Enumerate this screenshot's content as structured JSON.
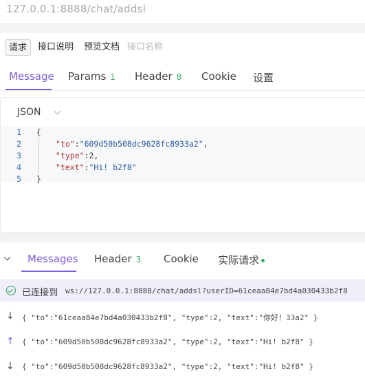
{
  "url": "127.0.0.1:8888/chat/addsl",
  "sub_tabs": [
    {
      "label": "请求"
    },
    {
      "label": "接口说明"
    },
    {
      "label": "预览文档"
    }
  ],
  "api_name_placeholder": "接口名称",
  "main_tabs": [
    {
      "label": "Message",
      "badge": ""
    },
    {
      "label": "Params",
      "badge": "1"
    },
    {
      "label": "Header",
      "badge": "8"
    },
    {
      "label": "Cookie",
      "badge": ""
    },
    {
      "label": "设置",
      "badge": ""
    }
  ],
  "body_format": "JSON",
  "code_lines": [
    {
      "no": "1"
    },
    {
      "no": "2",
      "key": "\"to\"",
      "value": "\"609d50b508dc9628fc8933a2\""
    },
    {
      "no": "3",
      "key": "\"type\"",
      "value": "2"
    },
    {
      "no": "4",
      "key": "\"text\"",
      "value": "\"Hi! b2f8\""
    },
    {
      "no": "5"
    }
  ],
  "code_tokens": {
    "open": "{",
    "close": "}",
    "colon": ":",
    "comma": ","
  },
  "response_tabs": [
    {
      "label": "Messages",
      "badge": ""
    },
    {
      "label": "Header",
      "badge": "3"
    },
    {
      "label": "Cookie",
      "badge": ""
    },
    {
      "label": "实际请求",
      "badge": ""
    }
  ],
  "connection": {
    "label": "已连接到",
    "url": "ws://127.0.0.1:8888/chat/addsl?userID=61ceaa84e7bd4a030433b2f8",
    "status_color": "#28b463"
  },
  "messages": [
    {
      "direction": "received",
      "arrow": "↓",
      "text": "{ \"to\":\"61ceaa84e7bd4a030433b2f8\", \"type\":2, \"text\":\"你好！33a2\" }"
    },
    {
      "direction": "sent",
      "arrow": "↑",
      "text": "{ \"to\":\"609d50b508dc9628fc8933a2\", \"type\":2, \"text\":\"Hi! b2f8\" }"
    },
    {
      "direction": "received",
      "arrow": "↓",
      "text": "{ \"to\":\"609d50b508dc9628fc8933a2\", \"type\":2, \"text\":\"Hi! b2f8\" }"
    }
  ],
  "colors": {
    "accent": "#7a5ce0",
    "badge": "#3fa96b",
    "connected_bg": "#f1eefb"
  }
}
